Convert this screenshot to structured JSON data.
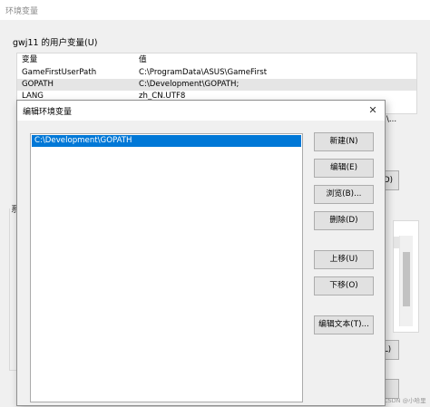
{
  "background_window": {
    "title": "环境变量",
    "user_group_label": "gwj11 的用户变量(U)",
    "columns": [
      "变量",
      "值"
    ],
    "rows": [
      {
        "name": "GameFirstUserPath",
        "value": "C:\\ProgramData\\ASUS\\GameFirst"
      },
      {
        "name": "GOPATH",
        "value": "C:\\Development\\GOPATH;"
      },
      {
        "name": "LANG",
        "value": "zh_CN.UTF8"
      }
    ],
    "row_tail": "\\...",
    "right_button_1": "D)",
    "sys_char": "系",
    "right_button_2": "L)",
    "watermark": "CSDN @小哈里"
  },
  "dialog": {
    "title": "编辑环境变量",
    "close_glyph": "✕",
    "list_items": [
      "C:\\Development\\GOPATH"
    ],
    "buttons": {
      "new": "新建(N)",
      "edit": "编辑(E)",
      "browse": "浏览(B)...",
      "delete": "删除(D)",
      "move_up": "上移(U)",
      "move_down": "下移(O)",
      "edit_text": "编辑文本(T)..."
    }
  },
  "colors": {
    "selection": "#0078d7",
    "window_bg": "#f0f0f0",
    "button_bg": "#e1e1e1"
  }
}
